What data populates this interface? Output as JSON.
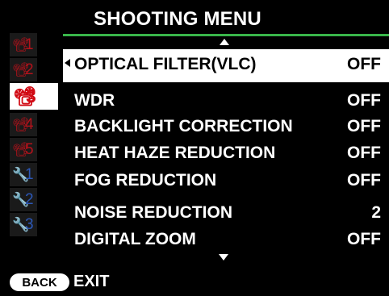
{
  "header": {
    "title": "SHOOTING MENU"
  },
  "tabs": [
    {
      "icon": "camera-icon",
      "glyph": "📽",
      "number": "1",
      "kind": "cam"
    },
    {
      "icon": "camera-icon",
      "glyph": "📽",
      "number": "2",
      "kind": "cam"
    },
    {
      "icon": "camera-icon",
      "glyph": "📽",
      "number": "3",
      "kind": "cam",
      "active": true
    },
    {
      "icon": "camera-icon",
      "glyph": "📽",
      "number": "4",
      "kind": "cam"
    },
    {
      "icon": "camera-icon",
      "glyph": "📽",
      "number": "5",
      "kind": "cam"
    },
    {
      "icon": "wrench-icon",
      "glyph": "🔧",
      "number": "1",
      "kind": "tool"
    },
    {
      "icon": "wrench-icon",
      "glyph": "🔧",
      "number": "2",
      "kind": "tool"
    },
    {
      "icon": "wrench-icon",
      "glyph": "🔧",
      "number": "3",
      "kind": "tool"
    }
  ],
  "menu": {
    "items": [
      {
        "label": "OPTICAL FILTER(VLC)",
        "value": "OFF",
        "selected": true
      },
      {
        "label": "WDR",
        "value": "OFF"
      },
      {
        "label": "BACKLIGHT CORRECTION",
        "value": "OFF"
      },
      {
        "label": "HEAT HAZE REDUCTION",
        "value": "OFF"
      },
      {
        "label": "FOG REDUCTION",
        "value": "OFF"
      },
      {
        "label": "NOISE REDUCTION",
        "value": "2"
      },
      {
        "label": "DIGITAL ZOOM",
        "value": "OFF"
      }
    ]
  },
  "footer": {
    "back_label": "BACK",
    "exit_label": "EXIT"
  },
  "colors": {
    "accent_line": "#39b54a",
    "camera_tab": "#b3121b",
    "tool_tab": "#2c58b8"
  }
}
